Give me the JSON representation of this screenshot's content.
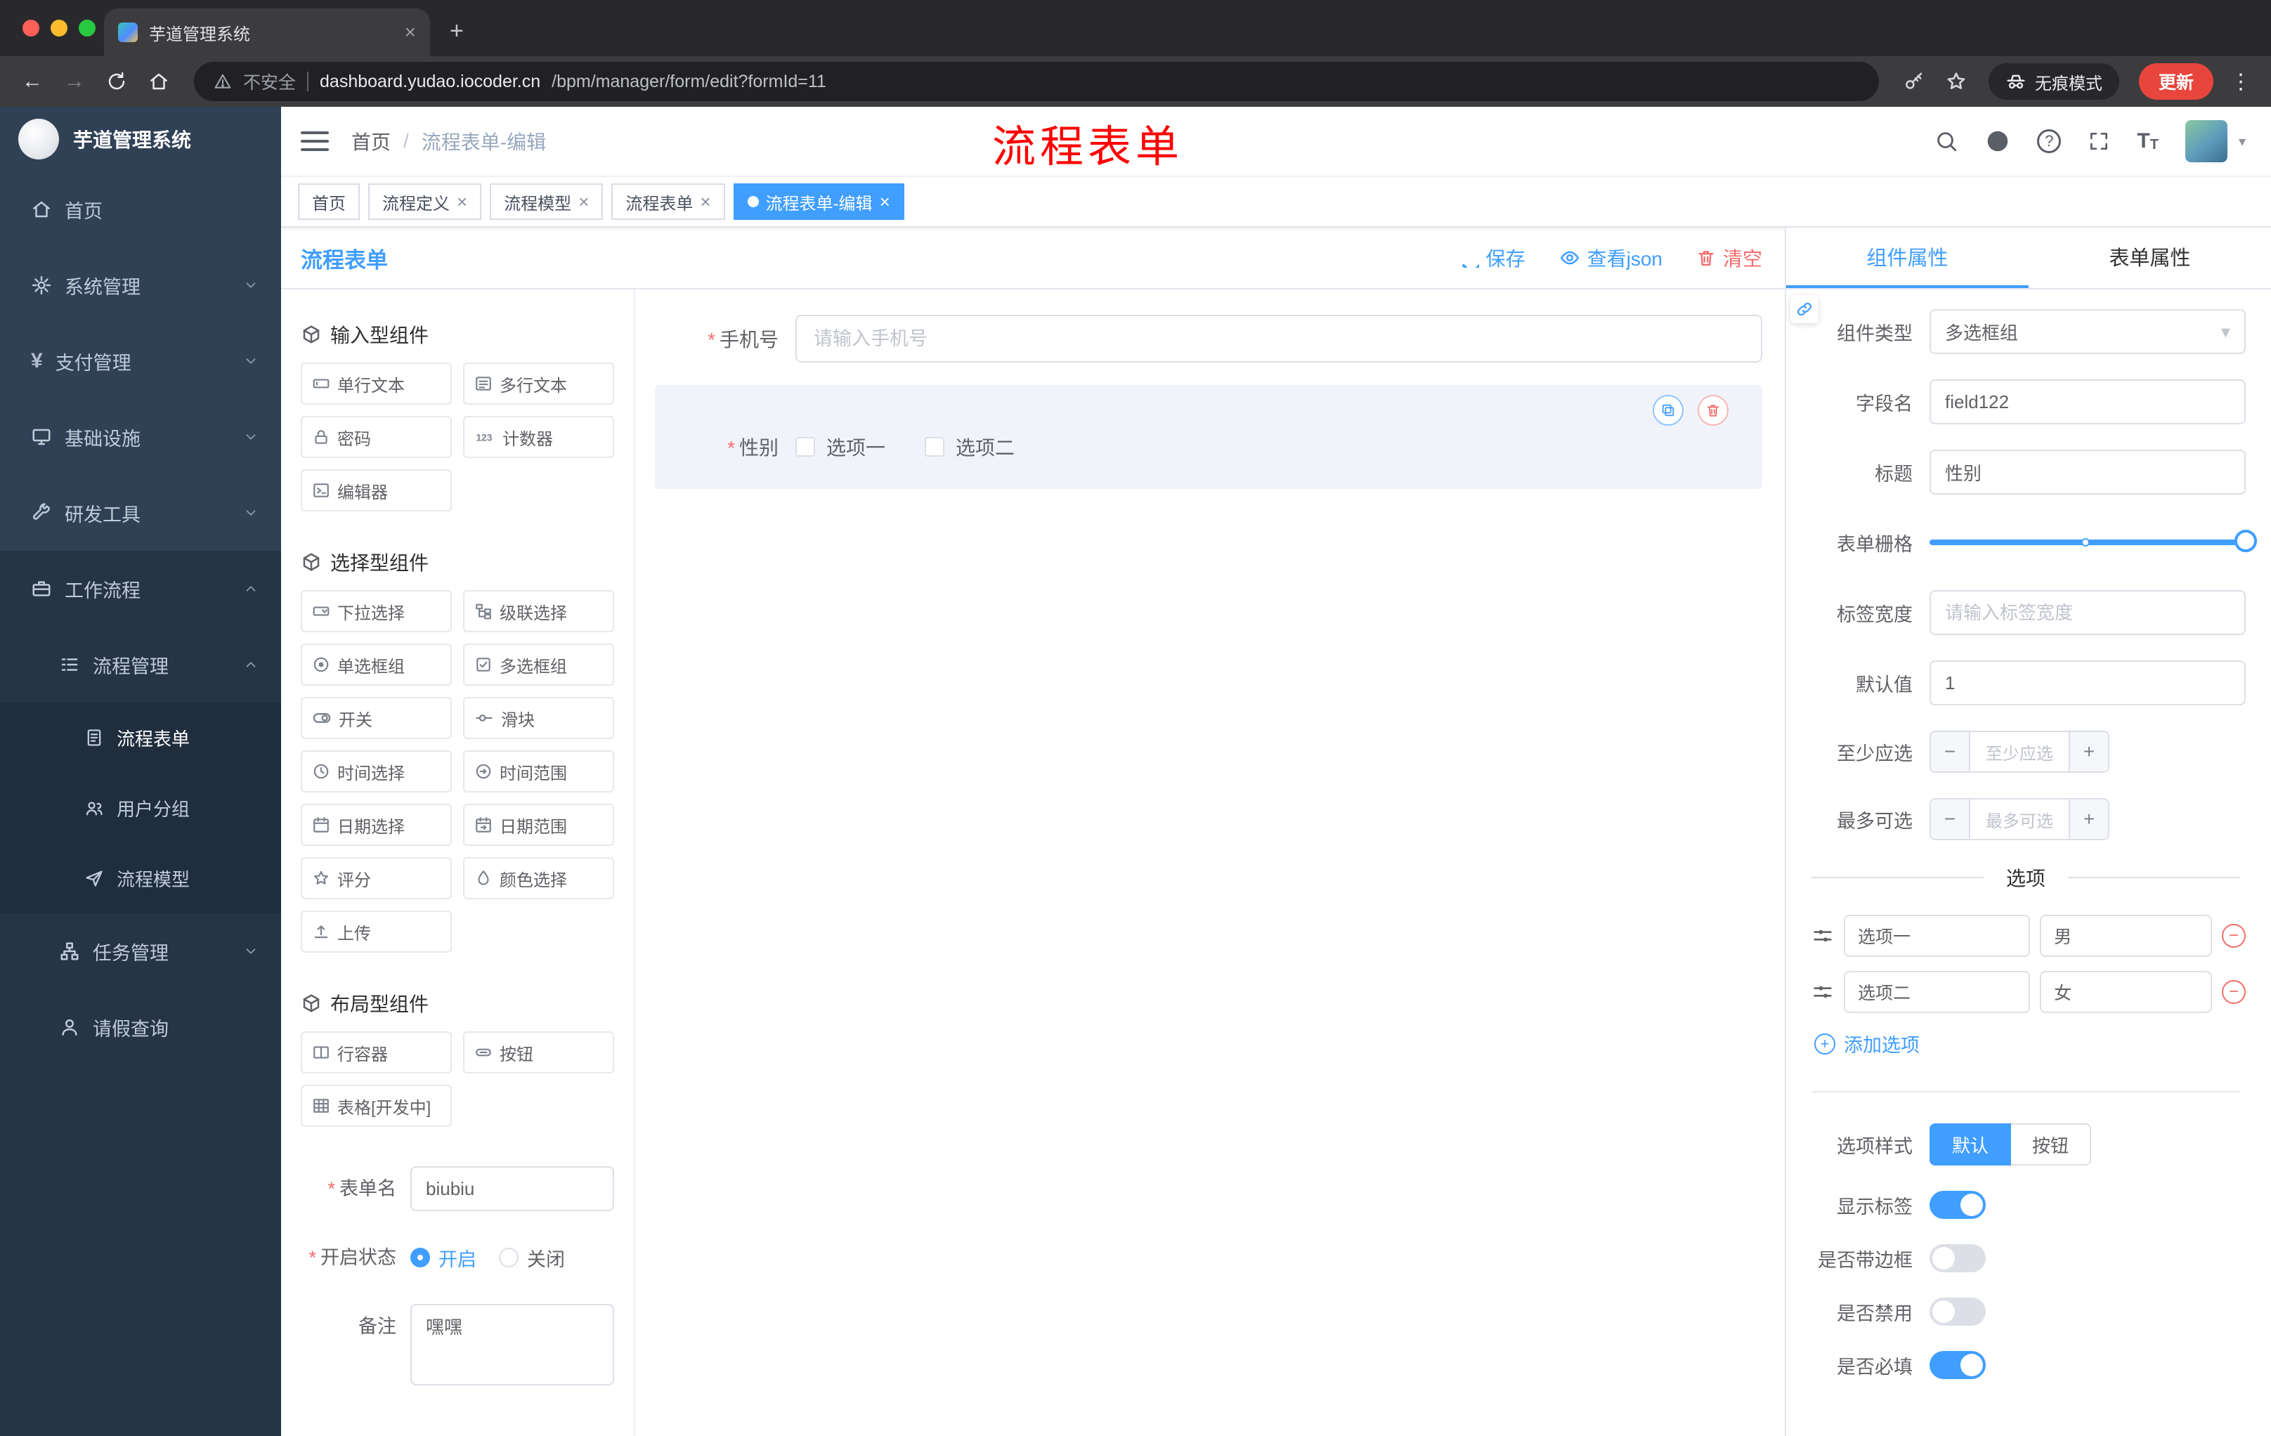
{
  "glyphs": {
    "close": "×",
    "plus": "+",
    "minus": "−",
    "kebab": "⋮",
    "caret": "▾",
    "dot": "●",
    "required": "*",
    "sep": "/",
    "back": "←",
    "forward": "→",
    "question": "?",
    "font_big": "T",
    "font_small": "T"
  },
  "browser": {
    "tab_title": "芋道管理系统",
    "security": "不安全",
    "url_host": "dashboard.yudao.iocoder.cn",
    "url_path": "/bpm/manager/form/edit?formId=11",
    "incognito": "无痕模式",
    "update": "更新"
  },
  "sidebar": {
    "app_title": "芋道管理系统",
    "top": [
      "首页",
      "系统管理",
      "支付管理",
      "基础设施",
      "研发工具",
      "工作流程"
    ],
    "sub": [
      "流程管理",
      "流程表单",
      "用户分组",
      "流程模型",
      "任务管理",
      "请假查询"
    ]
  },
  "header": {
    "breadcrumb_home": "首页",
    "breadcrumb_current": "流程表单-编辑",
    "annotation": "流程表单"
  },
  "tags": [
    "首页",
    "流程定义",
    "流程模型",
    "流程表单",
    "流程表单-编辑"
  ],
  "designer": {
    "title": "流程表单",
    "save": "保存",
    "view_json": "查看json",
    "clear": "清空",
    "groups": [
      {
        "title": "输入型组件",
        "items": [
          "单行文本",
          "多行文本",
          "密码",
          "计数器",
          "编辑器"
        ]
      },
      {
        "title": "选择型组件",
        "items": [
          "下拉选择",
          "级联选择",
          "单选框组",
          "多选框组",
          "开关",
          "滑块",
          "时间选择",
          "时间范围",
          "日期选择",
          "日期范围",
          "评分",
          "颜色选择",
          "上传"
        ]
      },
      {
        "title": "布局型组件",
        "items": [
          "行容器",
          "按钮",
          "表格[开发中]"
        ]
      }
    ],
    "form": {
      "name_label": "表单名",
      "name_value": "biubiu",
      "status_label": "开启状态",
      "on": "开启",
      "off": "关闭",
      "remark_label": "备注",
      "remark_value": "嘿嘿"
    },
    "canvas": {
      "phone_label": "手机号",
      "phone_placeholder": "请输入手机号",
      "gender_label": "性别",
      "gender_options": [
        "选项一",
        "选项二"
      ]
    }
  },
  "props": {
    "tab_component": "组件属性",
    "tab_form": "表单属性",
    "rows": {
      "type_label": "组件类型",
      "type_value": "多选框组",
      "field_label": "字段名",
      "field_value": "field122",
      "title_label": "标题",
      "title_value": "性别",
      "grid_label": "表单栅格",
      "width_label": "标签宽度",
      "width_placeholder": "请输入标签宽度",
      "default_label": "默认值",
      "default_value": "1",
      "min_label": "至少应选",
      "min_placeholder": "至少应选",
      "max_label": "最多可选",
      "max_placeholder": "最多可选"
    },
    "options_title": "选项",
    "options": [
      {
        "label": "选项一",
        "value": "男"
      },
      {
        "label": "选项二",
        "value": "女"
      }
    ],
    "add_option": "添加选项",
    "style_label": "选项样式",
    "style_default": "默认",
    "style_button": "按钮",
    "switch_rows": [
      "显示标签",
      "是否带边框",
      "是否禁用",
      "是否必填"
    ]
  }
}
